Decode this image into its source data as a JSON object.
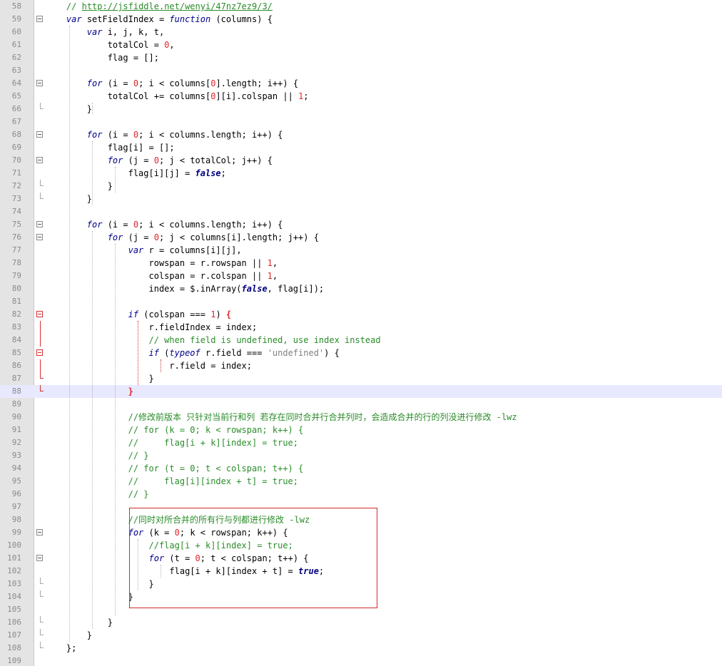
{
  "editor": {
    "first_line": 58,
    "current_line": 88,
    "accent_colors": {
      "keyword": "#00008b",
      "number": "#e0262a",
      "comment": "#2a8c2a",
      "highlight_box": "#d22a2a"
    }
  },
  "lines": [
    {
      "n": "58",
      "tokens": [
        {
          "t": "    "
        },
        {
          "t": "// ",
          "c": "cmt"
        },
        {
          "t": "http://jsfiddle.net/wenyi/47nz7ez9/3/",
          "c": "lnk"
        }
      ]
    },
    {
      "n": "59",
      "fold": "open",
      "tokens": [
        {
          "t": "    "
        },
        {
          "t": "var",
          "c": "kw"
        },
        {
          "t": " setFieldIndex = "
        },
        {
          "t": "function",
          "c": "kw"
        },
        {
          "t": " (columns) {"
        }
      ]
    },
    {
      "n": "60",
      "tokens": [
        {
          "t": "        "
        },
        {
          "t": "var",
          "c": "kw"
        },
        {
          "t": " i, j, k, t,"
        }
      ]
    },
    {
      "n": "61",
      "tokens": [
        {
          "t": "            totalCol = "
        },
        {
          "t": "0",
          "c": "num"
        },
        {
          "t": ","
        }
      ]
    },
    {
      "n": "62",
      "tokens": [
        {
          "t": "            flag = [];"
        }
      ]
    },
    {
      "n": "63",
      "tokens": []
    },
    {
      "n": "64",
      "fold": "open",
      "tokens": [
        {
          "t": "        "
        },
        {
          "t": "for",
          "c": "kw"
        },
        {
          "t": " (i = "
        },
        {
          "t": "0",
          "c": "num"
        },
        {
          "t": "; i < columns["
        },
        {
          "t": "0",
          "c": "num"
        },
        {
          "t": "].length; i++) {"
        }
      ]
    },
    {
      "n": "65",
      "tokens": [
        {
          "t": "            totalCol += columns["
        },
        {
          "t": "0",
          "c": "num"
        },
        {
          "t": "][i].colspan || "
        },
        {
          "t": "1",
          "c": "num"
        },
        {
          "t": ";"
        }
      ]
    },
    {
      "n": "66",
      "fold": "end",
      "tokens": [
        {
          "t": "        }"
        }
      ]
    },
    {
      "n": "67",
      "tokens": []
    },
    {
      "n": "68",
      "fold": "open",
      "tokens": [
        {
          "t": "        "
        },
        {
          "t": "for",
          "c": "kw"
        },
        {
          "t": " (i = "
        },
        {
          "t": "0",
          "c": "num"
        },
        {
          "t": "; i < columns.length; i++) {"
        }
      ]
    },
    {
      "n": "69",
      "tokens": [
        {
          "t": "            flag[i] = [];"
        }
      ]
    },
    {
      "n": "70",
      "fold": "open",
      "tokens": [
        {
          "t": "            "
        },
        {
          "t": "for",
          "c": "kw"
        },
        {
          "t": " (j = "
        },
        {
          "t": "0",
          "c": "num"
        },
        {
          "t": "; j < totalCol; j++) {"
        }
      ]
    },
    {
      "n": "71",
      "tokens": [
        {
          "t": "                flag[i][j] = "
        },
        {
          "t": "false",
          "c": "bool"
        },
        {
          "t": ";"
        }
      ]
    },
    {
      "n": "72",
      "fold": "end",
      "tokens": [
        {
          "t": "            }"
        }
      ]
    },
    {
      "n": "73",
      "fold": "end",
      "tokens": [
        {
          "t": "        }"
        }
      ]
    },
    {
      "n": "74",
      "tokens": []
    },
    {
      "n": "75",
      "fold": "open",
      "tokens": [
        {
          "t": "        "
        },
        {
          "t": "for",
          "c": "kw"
        },
        {
          "t": " (i = "
        },
        {
          "t": "0",
          "c": "num"
        },
        {
          "t": "; i < columns.length; i++) {"
        }
      ]
    },
    {
      "n": "76",
      "fold": "open",
      "tokens": [
        {
          "t": "            "
        },
        {
          "t": "for",
          "c": "kw"
        },
        {
          "t": " (j = "
        },
        {
          "t": "0",
          "c": "num"
        },
        {
          "t": "; j < columns[i].length; j++) {"
        }
      ]
    },
    {
      "n": "77",
      "tokens": [
        {
          "t": "                "
        },
        {
          "t": "var",
          "c": "kw"
        },
        {
          "t": " r = columns[i][j],"
        }
      ]
    },
    {
      "n": "78",
      "tokens": [
        {
          "t": "                    rowspan = r.rowspan || "
        },
        {
          "t": "1",
          "c": "num"
        },
        {
          "t": ","
        }
      ]
    },
    {
      "n": "79",
      "tokens": [
        {
          "t": "                    colspan = r.colspan || "
        },
        {
          "t": "1",
          "c": "num"
        },
        {
          "t": ","
        }
      ]
    },
    {
      "n": "80",
      "tokens": [
        {
          "t": "                    index = $.inArray("
        },
        {
          "t": "false",
          "c": "bool"
        },
        {
          "t": ", flag[i]);"
        }
      ]
    },
    {
      "n": "81",
      "tokens": []
    },
    {
      "n": "82",
      "fold": "open-red",
      "tokens": [
        {
          "t": "                "
        },
        {
          "t": "if",
          "c": "kw"
        },
        {
          "t": " (colspan === "
        },
        {
          "t": "1",
          "c": "num"
        },
        {
          "t": ") "
        },
        {
          "t": "{",
          "c": "brace-red"
        }
      ]
    },
    {
      "n": "83",
      "fold": "red",
      "tokens": [
        {
          "t": "                    r.fieldIndex = index;"
        }
      ]
    },
    {
      "n": "84",
      "fold": "red",
      "tokens": [
        {
          "t": "                    "
        },
        {
          "t": "// when field is undefined, use index instead",
          "c": "cmt"
        }
      ]
    },
    {
      "n": "85",
      "fold": "open-red",
      "tokens": [
        {
          "t": "                    "
        },
        {
          "t": "if",
          "c": "kw"
        },
        {
          "t": " ("
        },
        {
          "t": "typeof",
          "c": "kw"
        },
        {
          "t": " r.field === "
        },
        {
          "t": "'undefined'",
          "c": "str"
        },
        {
          "t": ") {"
        }
      ]
    },
    {
      "n": "86",
      "fold": "red",
      "tokens": [
        {
          "t": "                        r.field = index;"
        }
      ]
    },
    {
      "n": "87",
      "fold": "end-red",
      "tokens": [
        {
          "t": "                    }"
        }
      ]
    },
    {
      "n": "88",
      "fold": "end-red",
      "tokens": [
        {
          "t": "                "
        },
        {
          "t": "}",
          "c": "brace-red"
        }
      ]
    },
    {
      "n": "89",
      "tokens": []
    },
    {
      "n": "90",
      "tokens": [
        {
          "t": "                "
        },
        {
          "t": "//修改前版本 只针对当前行和列 若存在同时合并行合并列时，会造成合并的行的列没进行修改 -lwz",
          "c": "cmt"
        }
      ]
    },
    {
      "n": "91",
      "tokens": [
        {
          "t": "                "
        },
        {
          "t": "// for (k = 0; k < rowspan; k++) {",
          "c": "cmt"
        }
      ]
    },
    {
      "n": "92",
      "tokens": [
        {
          "t": "                "
        },
        {
          "t": "//     flag[i + k][index] = true;",
          "c": "cmt"
        }
      ]
    },
    {
      "n": "93",
      "tokens": [
        {
          "t": "                "
        },
        {
          "t": "// }",
          "c": "cmt"
        }
      ]
    },
    {
      "n": "94",
      "tokens": [
        {
          "t": "                "
        },
        {
          "t": "// for (t = 0; t < colspan; t++) {",
          "c": "cmt"
        }
      ]
    },
    {
      "n": "95",
      "tokens": [
        {
          "t": "                "
        },
        {
          "t": "//     flag[i][index + t] = true;",
          "c": "cmt"
        }
      ]
    },
    {
      "n": "96",
      "tokens": [
        {
          "t": "                "
        },
        {
          "t": "// }",
          "c": "cmt"
        }
      ]
    },
    {
      "n": "97",
      "tokens": []
    },
    {
      "n": "98",
      "tokens": [
        {
          "t": "                "
        },
        {
          "t": "//同时对所合并的所有行与列都进行修改 -lwz",
          "c": "cmt"
        }
      ]
    },
    {
      "n": "99",
      "fold": "open",
      "tokens": [
        {
          "t": "                "
        },
        {
          "t": "for",
          "c": "kw"
        },
        {
          "t": " (k = "
        },
        {
          "t": "0",
          "c": "num"
        },
        {
          "t": "; k < rowspan; k++) {"
        }
      ]
    },
    {
      "n": "100",
      "tokens": [
        {
          "t": "                    "
        },
        {
          "t": "//flag[i + k][index] = true;",
          "c": "cmt"
        }
      ]
    },
    {
      "n": "101",
      "fold": "open",
      "tokens": [
        {
          "t": "                    "
        },
        {
          "t": "for",
          "c": "kw"
        },
        {
          "t": " (t = "
        },
        {
          "t": "0",
          "c": "num"
        },
        {
          "t": "; t < colspan; t++) {"
        }
      ]
    },
    {
      "n": "102",
      "tokens": [
        {
          "t": "                        flag[i + k][index + t] = "
        },
        {
          "t": "true",
          "c": "bool"
        },
        {
          "t": ";"
        }
      ]
    },
    {
      "n": "103",
      "fold": "end",
      "tokens": [
        {
          "t": "                    }"
        }
      ]
    },
    {
      "n": "104",
      "fold": "end",
      "tokens": [
        {
          "t": "                }"
        }
      ]
    },
    {
      "n": "105",
      "tokens": []
    },
    {
      "n": "106",
      "fold": "end",
      "tokens": [
        {
          "t": "            }"
        }
      ]
    },
    {
      "n": "107",
      "fold": "end",
      "tokens": [
        {
          "t": "        }"
        }
      ]
    },
    {
      "n": "108",
      "fold": "end",
      "tokens": [
        {
          "t": "    };"
        }
      ]
    },
    {
      "n": "109",
      "tokens": []
    }
  ]
}
